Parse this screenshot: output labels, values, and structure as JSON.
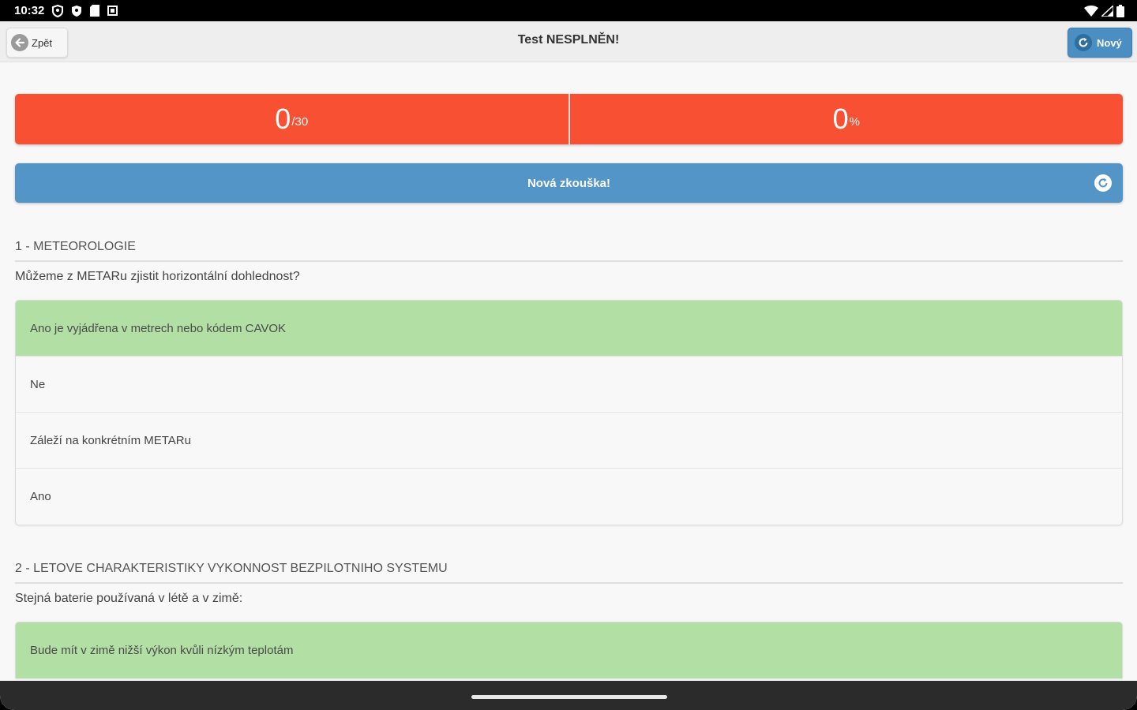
{
  "status_bar": {
    "time": "10:32",
    "left_icons": [
      "location-shield-icon",
      "shield-icon",
      "sd-card-icon",
      "square-notification-icon"
    ],
    "right_icons": [
      "wifi-icon",
      "signal-icon",
      "battery-icon"
    ]
  },
  "header": {
    "back_label": "Zpět",
    "title": "Test NESPLNĚN!",
    "new_label": "Nový"
  },
  "score": {
    "points": "0",
    "points_total": "/30",
    "percent": "0",
    "percent_unit": "%"
  },
  "retry_label": "Nová zkouška!",
  "questions": [
    {
      "heading": "1 - METEOROLOGIE",
      "text": "Můžeme z METARu zjistit horizontální dohlednost?",
      "answers": [
        {
          "text": "Ano je vyjádřena v metrech nebo kódem CAVOK",
          "correct": true
        },
        {
          "text": "Ne",
          "correct": false
        },
        {
          "text": "Záleží na konkrétním METARu",
          "correct": false
        },
        {
          "text": "Ano",
          "correct": false
        }
      ]
    },
    {
      "heading": "2 - LETOVE CHARAKTERISTIKY VYKONNOST BEZPILOTNIHO SYSTEMU",
      "text": "Stejná baterie používaná v létě a v zimě:",
      "answers": [
        {
          "text": "Bude mít v zimě nižší výkon kvůli nízkým teplotám",
          "correct": true
        }
      ]
    }
  ],
  "colors": {
    "fail_red": "#f85032",
    "primary_blue": "#5395c6",
    "correct_green": "#b2dfa4"
  }
}
